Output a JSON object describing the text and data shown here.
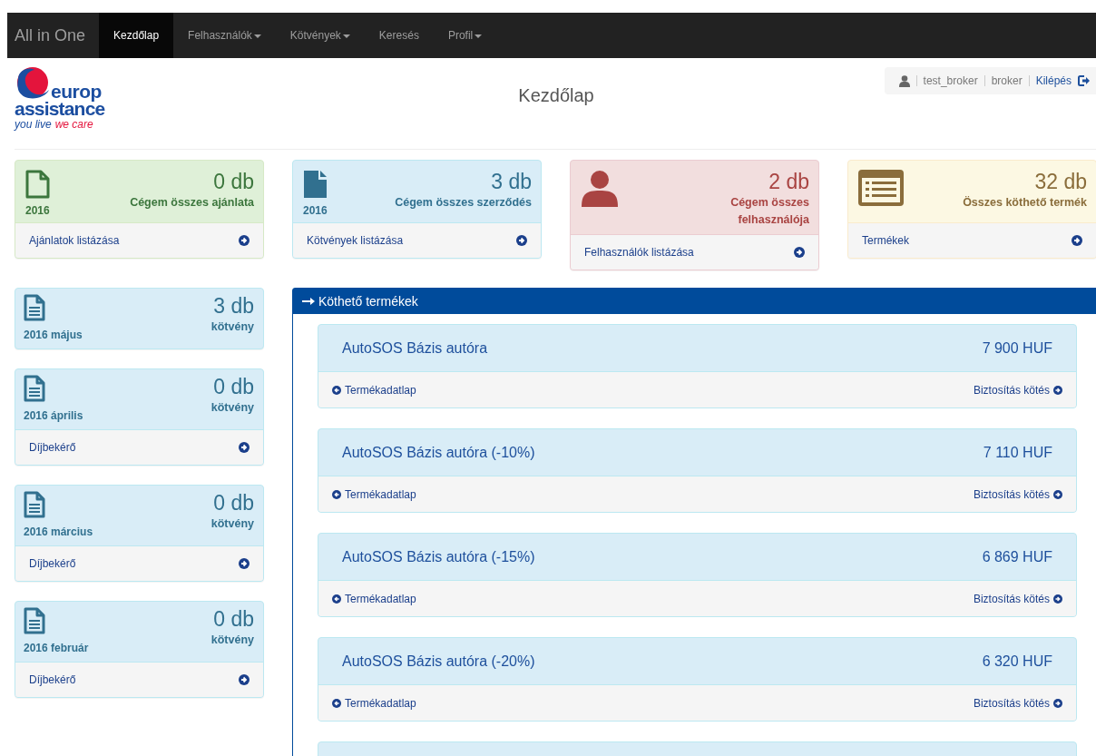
{
  "navbar": {
    "brand": "All in One",
    "items": [
      {
        "label": "Kezdőlap",
        "dropdown": false,
        "selected": true
      },
      {
        "label": "Felhasználók",
        "dropdown": true,
        "selected": false
      },
      {
        "label": "Kötvények",
        "dropdown": true,
        "selected": false
      },
      {
        "label": "Keresés",
        "dropdown": false,
        "selected": false
      },
      {
        "label": "Profil",
        "dropdown": true,
        "selected": false
      }
    ]
  },
  "logo": {
    "line_1": "europ",
    "line_2": "assistance",
    "slogan_1": "you live",
    "slogan_2": "we care"
  },
  "page_title": "Kezdőlap",
  "user_bar": {
    "username": "test_broker",
    "role": "broker",
    "logout": "Kilépés"
  },
  "stat_cards": [
    {
      "count": "0 db",
      "year": "2016",
      "label": "Cégem összes ajánlata",
      "link": "Ajánlatok listázása"
    },
    {
      "count": "3 db",
      "year": "2016",
      "label": "Cégem összes szerződés",
      "link": "Kötvények listázása"
    },
    {
      "count": "2 db",
      "label": "Cégem összes felhasználója",
      "link": "Felhasználók listázása"
    },
    {
      "count": "32 db",
      "label": "Összes köthető termék",
      "link": "Termékek"
    }
  ],
  "monthly_cards": [
    {
      "period": "2016 május",
      "count": "3 db",
      "unit": "kötvény"
    },
    {
      "period": "2016 április",
      "count": "0 db",
      "unit": "kötvény",
      "link": "Díjbekérő"
    },
    {
      "period": "2016 március",
      "count": "0 db",
      "unit": "kötvény",
      "link": "Díjbekérő"
    },
    {
      "period": "2016 február",
      "count": "0 db",
      "unit": "kötvény",
      "link": "Díjbekérő"
    }
  ],
  "products_panel": {
    "title": "Köthető termékek",
    "items": [
      {
        "name": "AutoSOS Bázis autóra",
        "price": "7 900 HUF",
        "details_link": "Termékadatlap",
        "buy_link": "Biztosítás kötés"
      },
      {
        "name": "AutoSOS Bázis autóra (-10%)",
        "price": "7 110 HUF",
        "details_link": "Termékadatlap",
        "buy_link": "Biztosítás kötés"
      },
      {
        "name": "AutoSOS Bázis autóra (-15%)",
        "price": "6 869 HUF",
        "details_link": "Termékadatlap",
        "buy_link": "Biztosítás kötés"
      },
      {
        "name": "AutoSOS Bázis autóra (-20%)",
        "price": "6 320 HUF",
        "details_link": "Termékadatlap",
        "buy_link": "Biztosítás kötés"
      }
    ]
  }
}
